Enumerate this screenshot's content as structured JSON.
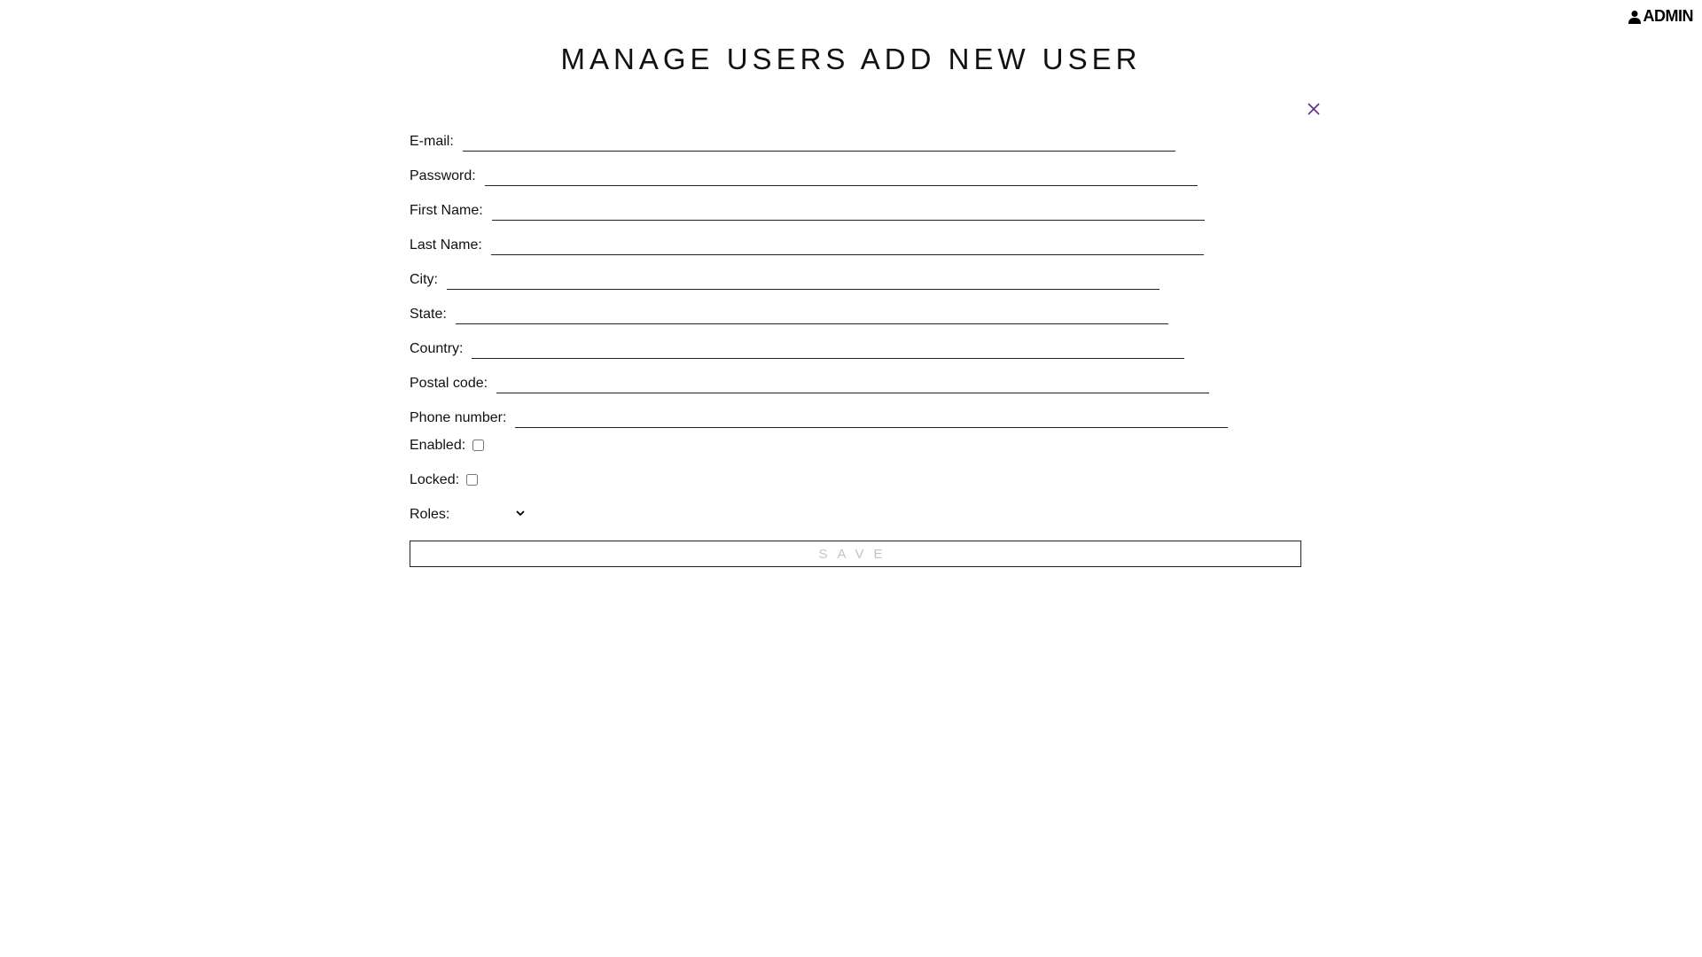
{
  "header": {
    "user_label": "ADMIN",
    "user_icon": "person-icon"
  },
  "title": "MANAGE USERS ADD NEW USER",
  "close_icon": "close-icon",
  "colors": {
    "close_icon": "#5b2a86",
    "save_text": "#c4c4c4"
  },
  "form": {
    "email": {
      "label": "E-mail:",
      "value": ""
    },
    "password": {
      "label": "Password:",
      "value": ""
    },
    "first_name": {
      "label": "First Name:",
      "value": ""
    },
    "last_name": {
      "label": "Last Name:",
      "value": ""
    },
    "city": {
      "label": "City:",
      "value": ""
    },
    "state": {
      "label": "State:",
      "value": ""
    },
    "country": {
      "label": "Country:",
      "value": ""
    },
    "postal_code": {
      "label": "Postal code:",
      "value": ""
    },
    "phone_number": {
      "label": "Phone number:",
      "value": ""
    },
    "enabled": {
      "label": "Enabled:",
      "checked": false
    },
    "locked": {
      "label": "Locked:",
      "checked": false
    },
    "roles": {
      "label": "Roles:",
      "selected": ""
    },
    "save_label": "SAVE"
  }
}
